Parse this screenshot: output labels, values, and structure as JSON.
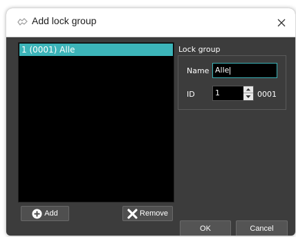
{
  "window": {
    "title": "Add lock group"
  },
  "list": {
    "items": [
      {
        "label": "1 (0001) Alle",
        "selected": true
      }
    ]
  },
  "buttons": {
    "add_label": "Add",
    "remove_label": "Remove",
    "ok_label": "OK",
    "cancel_label": "Cancel"
  },
  "lock_group": {
    "header": "Lock group",
    "name_label": "Name",
    "name_value": "Alle",
    "id_label": "ID",
    "id_value": "1",
    "id_hex": "0001"
  },
  "colors": {
    "accent": "#3cb4b9",
    "window_bg": "#3c3c3c",
    "list_bg": "#000000"
  },
  "icons": [
    "app-icon",
    "close-icon",
    "add-icon",
    "remove-icon",
    "spin-up-icon",
    "spin-down-icon"
  ]
}
